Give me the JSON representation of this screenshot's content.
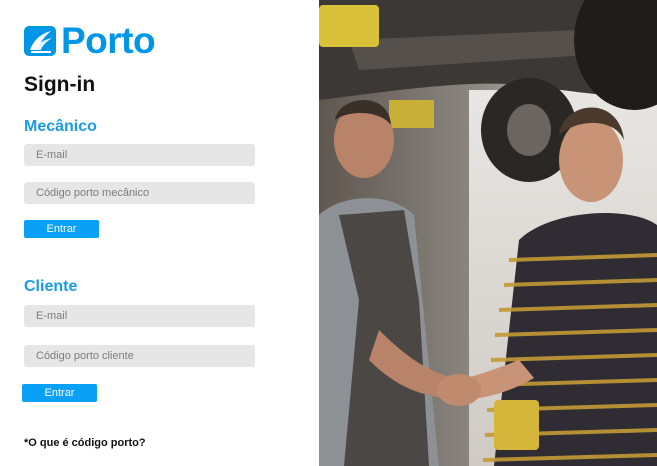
{
  "brand": {
    "name": "Porto",
    "logo_icon": "porto-flag-icon",
    "color": "#0096e6"
  },
  "page": {
    "title": "Sign-in",
    "footnote": "*O que é código porto?"
  },
  "mecanico": {
    "heading": "Mecânico",
    "email_placeholder": "E-mail",
    "code_placeholder": "Código porto mecânico",
    "submit_label": "Entrar"
  },
  "cliente": {
    "heading": "Cliente",
    "email_placeholder": "E-mail",
    "code_placeholder": "Código porto cliente",
    "submit_label": "Entrar"
  },
  "colors": {
    "accent": "#1a9be8",
    "button": "#0aa0f5",
    "field_bg": "#e6e6e6"
  }
}
